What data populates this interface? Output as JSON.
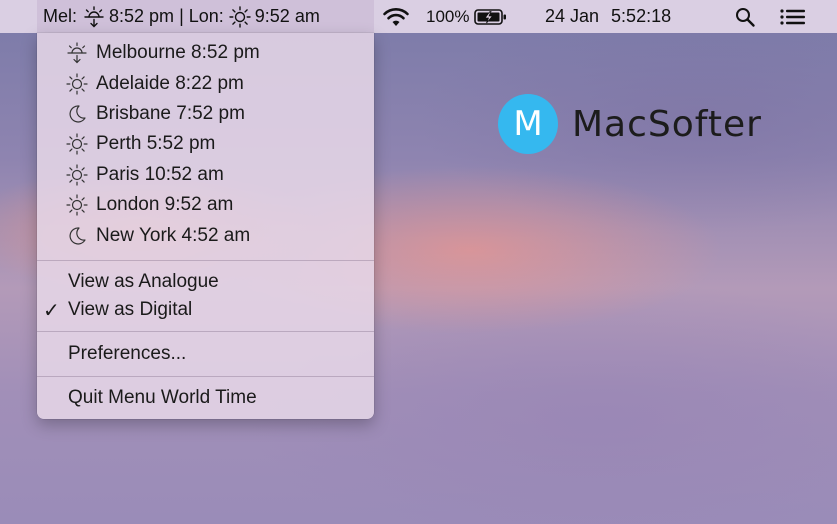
{
  "menubar": {
    "world_time_label": "Mel:",
    "world_time_mel_time": "8:52 pm",
    "world_time_sep": "| Lon:",
    "world_time_lon_time": "9:52 am",
    "battery_percent": "100%",
    "date": "24 Jan",
    "clock": "5:52:18",
    "icons": [
      "sunset-icon",
      "sun-icon",
      "wifi-icon",
      "battery-charging-icon",
      "search-icon",
      "menu-list-icon"
    ]
  },
  "world_time_menu": {
    "cities": [
      {
        "label": "Melbourne 8:52 pm",
        "icon": "sunset-icon"
      },
      {
        "label": "Adelaide 8:22 pm",
        "icon": "sun-icon"
      },
      {
        "label": "Brisbane 7:52 pm",
        "icon": "moon-icon"
      },
      {
        "label": "Perth 5:52 pm",
        "icon": "sun-icon"
      },
      {
        "label": "Paris 10:52 am",
        "icon": "sun-icon"
      },
      {
        "label": "London 9:52 am",
        "icon": "sun-icon"
      },
      {
        "label": "New York 4:52 am",
        "icon": "moon-icon"
      }
    ],
    "view_analogue": "View as Analogue",
    "view_digital": "View as Digital",
    "view_digital_checked": true,
    "preferences": "Preferences...",
    "quit": "Quit Menu World Time"
  },
  "watermark": {
    "badge_letter": "M",
    "text": "MacSofter",
    "badge_color": "#35b8ef"
  }
}
